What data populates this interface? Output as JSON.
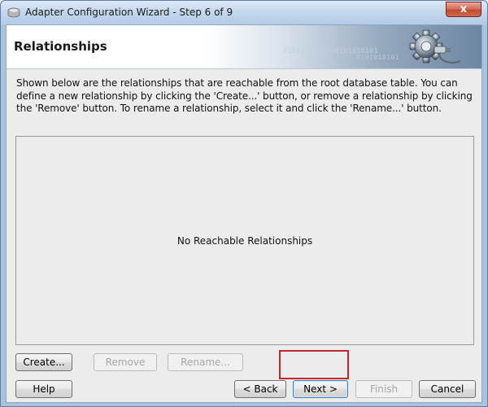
{
  "window": {
    "title": "Adapter Configuration Wizard - Step 6 of 9",
    "close_label": "x"
  },
  "banner": {
    "title": "Relationships",
    "binary_line1": "0101010101010101010101",
    "binary_line2": "0101010101"
  },
  "description": "Shown below are the relationships that are reachable from the root database table.  You can define a new relationship by clicking the 'Create...' button, or remove a relationship by clicking the 'Remove' button.  To rename a relationship, select it and click the 'Rename...' button.",
  "relationships": {
    "items": [],
    "empty_message": "No Reachable Relationships"
  },
  "actions": {
    "create": {
      "label": "Create...",
      "enabled": true
    },
    "remove": {
      "label": "Remove",
      "enabled": false
    },
    "rename": {
      "label": "Rename...",
      "enabled": false
    }
  },
  "footer": {
    "help": {
      "label": "Help",
      "enabled": true
    },
    "back": {
      "label": "< Back",
      "enabled": true
    },
    "next": {
      "label": "Next >",
      "enabled": true
    },
    "finish": {
      "label": "Finish",
      "enabled": false
    },
    "cancel": {
      "label": "Cancel",
      "enabled": true
    }
  },
  "colors": {
    "highlight_border": "#c0282b",
    "title_bar": "#c3d6ec",
    "close_button": "#c24a31",
    "dialog_background": "#ececec"
  }
}
